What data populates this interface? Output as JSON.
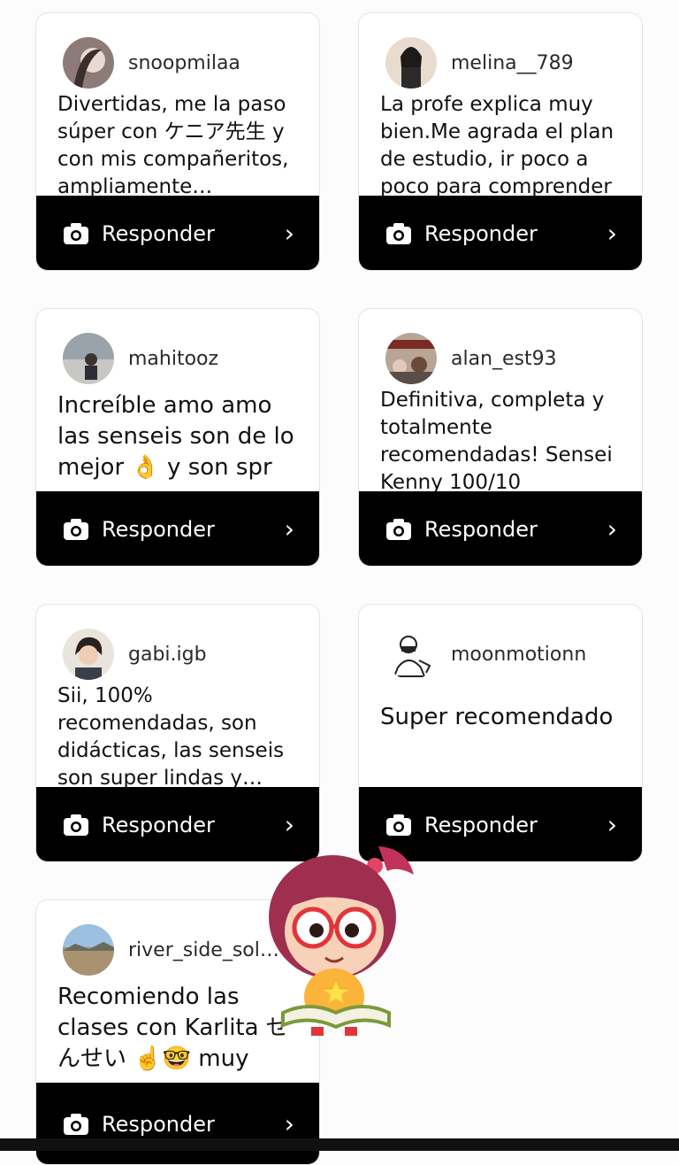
{
  "cards": [
    {
      "username": "snoopmilaa",
      "text": "Divertidas, me la paso súper con ケニア先生 y con mis compañeritos, ampliamente…",
      "reply_label": "Responder"
    },
    {
      "username": "melina__789",
      "text": "La profe explica muy bien.Me agrada el plan de estudio, ir poco a poco para comprender",
      "reply_label": "Responder"
    },
    {
      "username": "mahitooz",
      "text": "Increíble amo amo las senseis son de lo mejor 👌 y son spr",
      "reply_label": "Responder"
    },
    {
      "username": "alan_est93",
      "text": "Definitiva, completa y totalmente recomendadas! Sensei Kenny 100/10",
      "reply_label": "Responder"
    },
    {
      "username": "gabi.igb",
      "text": "Sii, 100% recomendadas, son didácticas, las senseis son super lindas y…",
      "reply_label": "Responder"
    },
    {
      "username": "moonmotionn",
      "text": "Super recomendado",
      "reply_label": "Responder"
    },
    {
      "username": "river_side_sol…",
      "text": "Recomiendo las clases con Karlita せんせい ☝️🤓 muy",
      "reply_label": "Responder"
    }
  ],
  "icons": {
    "reply": "camera-icon",
    "chevron": "chevron-right-icon"
  },
  "colors": {
    "reply_bar": "#000000",
    "card_bg": "#ffffff"
  }
}
